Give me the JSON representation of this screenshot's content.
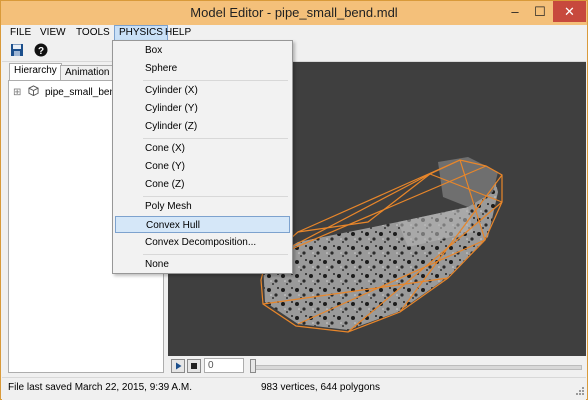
{
  "window": {
    "title": "Model Editor - pipe_small_bend.mdl"
  },
  "window_controls": {
    "minimize": "–",
    "maximize": "☐",
    "close": "✕"
  },
  "menubar": {
    "items": [
      "FILE",
      "VIEW",
      "TOOLS",
      "PHYSICS",
      "HELP"
    ],
    "active": "PHYSICS"
  },
  "toolbar": {
    "icons": [
      "save-icon",
      "help-icon"
    ]
  },
  "left_panel": {
    "tabs": [
      "Hierarchy",
      "Animation"
    ],
    "active_tab": "Hierarchy",
    "tree": [
      {
        "expander": "⊞",
        "label": "pipe_small_bend"
      }
    ]
  },
  "physics_menu": {
    "groups": [
      [
        "Box",
        "Sphere"
      ],
      [
        "Cylinder (X)",
        "Cylinder (Y)",
        "Cylinder (Z)"
      ],
      [
        "Cone (X)",
        "Cone (Y)",
        "Cone (Z)"
      ],
      [
        "Poly Mesh",
        "Convex Hull",
        "Convex Decomposition..."
      ],
      [
        "None"
      ]
    ],
    "highlighted": "Convex Hull"
  },
  "playbar": {
    "frame_value": "0"
  },
  "status": {
    "left": "File last saved March 22, 2015, 9:39 A.M.",
    "right": "983 vertices, 644 polygons"
  },
  "colors": {
    "title_bar": "#f4c07a",
    "close_button": "#c7493d",
    "viewport_bg": "#3f3f3f",
    "hull_lines": "#e8862a",
    "menu_highlight": "#d5e7f8"
  }
}
